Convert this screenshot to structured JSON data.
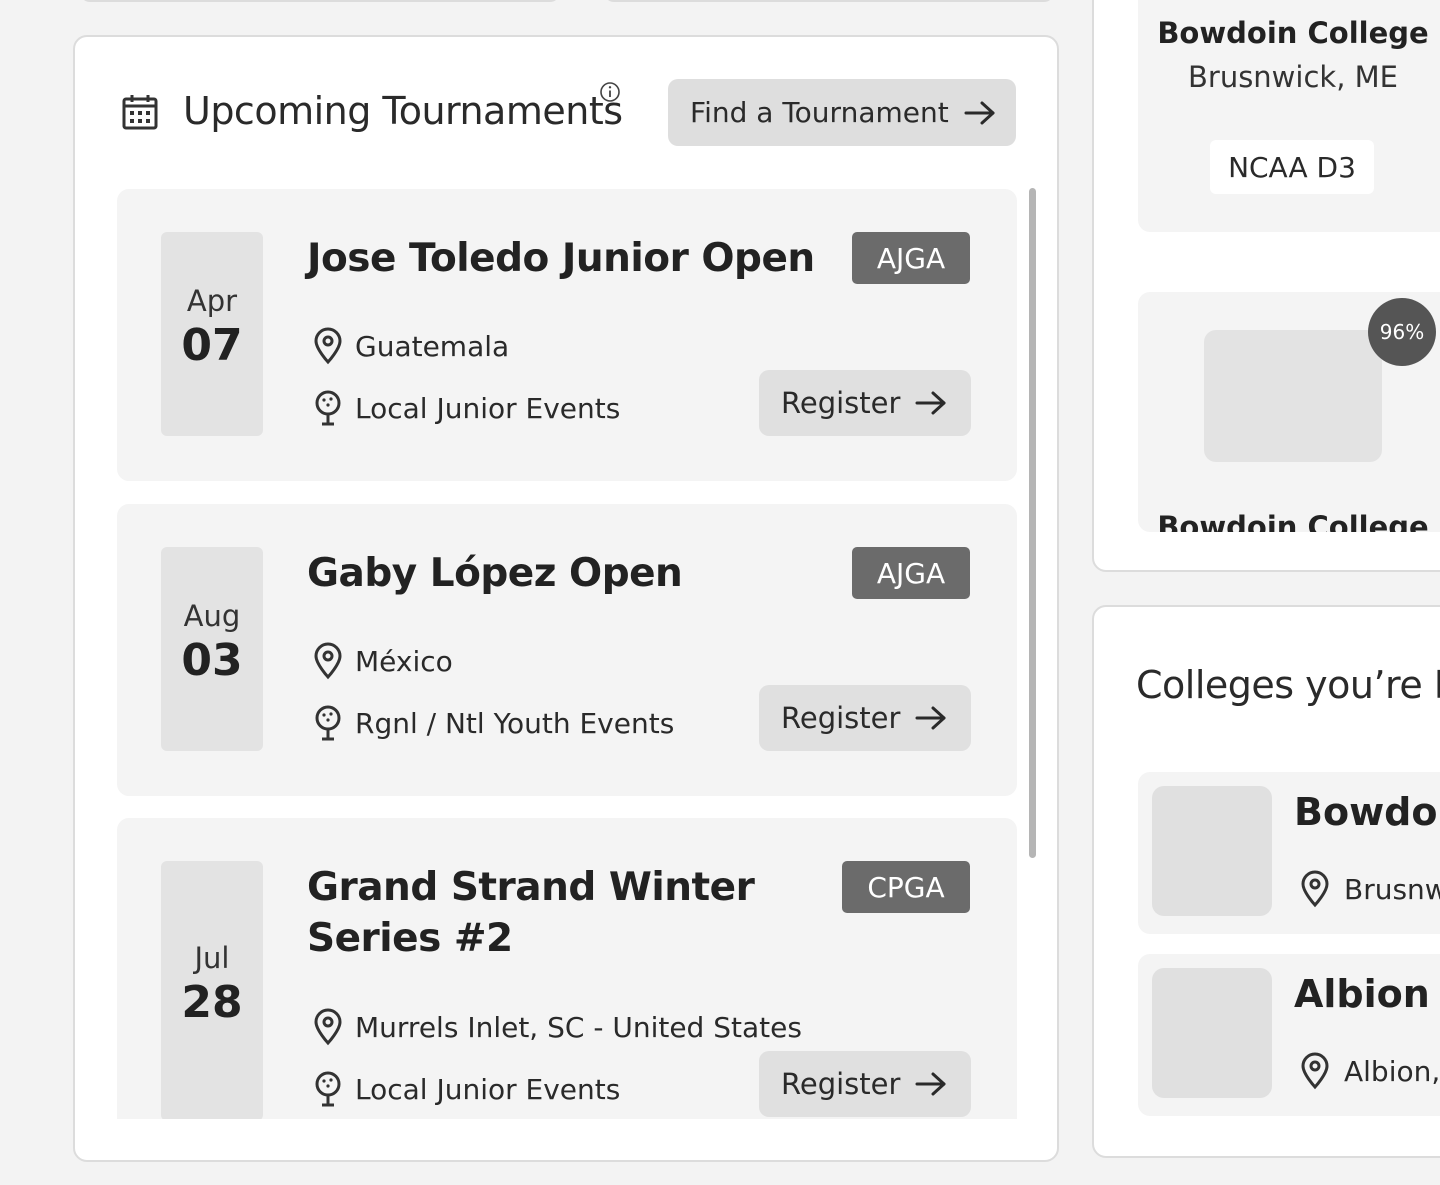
{
  "tournaments_panel": {
    "title": "Upcoming Tournaments",
    "find_button": "Find a Tournament",
    "register_label": "Register",
    "items": [
      {
        "month": "Apr",
        "day": "07",
        "name": "Jose Toledo Junior Open",
        "badge": "AJGA",
        "location": "Guatemala",
        "category": "Local Junior Events"
      },
      {
        "month": "Aug",
        "day": "03",
        "name": "Gaby López Open",
        "badge": "AJGA",
        "location": "México",
        "category": "Rgnl / Ntl Youth Events"
      },
      {
        "month": "Jul",
        "day": "28",
        "name": "Grand Strand Winter Series #2",
        "badge": "CPGA",
        "location": "Murrels Inlet, SC - United States",
        "category": "Local Junior Events"
      }
    ]
  },
  "college_card": {
    "name": "Bowdoin College",
    "location": "Brusnwick, ME",
    "division": "NCAA D3"
  },
  "match_card": {
    "percent": "96%",
    "name": "Bowdoin College"
  },
  "following_panel": {
    "title": "Colleges you’re Fo",
    "items": [
      {
        "name": "Bowdoin",
        "location": "Brusnw"
      },
      {
        "name": "Albion C",
        "location": "Albion,"
      }
    ]
  },
  "icons": {
    "calendar": "calendar-icon",
    "info": "info-icon",
    "arrow": "arrow-right-icon",
    "pin": "map-pin-icon",
    "golf": "golf-ball-icon"
  }
}
